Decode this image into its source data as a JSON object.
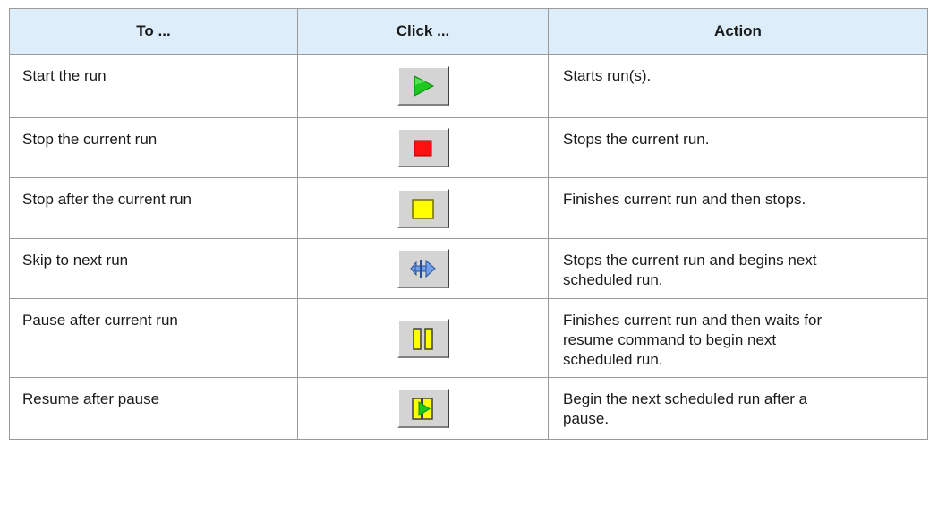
{
  "headers": {
    "to": "To ...",
    "click": "Click ...",
    "action": "Action"
  },
  "rows": [
    {
      "to": "Start the run",
      "icon": "start-run-icon",
      "action_lines": [
        "Starts run(s)."
      ]
    },
    {
      "to": "Stop the current run",
      "icon": "stop-run-icon",
      "action_lines": [
        "Stops the current run."
      ]
    },
    {
      "to": "Stop after the current run",
      "icon": "stop-after-run-icon",
      "action_lines": [
        "Finishes current run and then stops."
      ]
    },
    {
      "to": "Skip to next run",
      "icon": "skip-next-run-icon",
      "action_lines": [
        "Stops the current run and begins next",
        "scheduled run."
      ]
    },
    {
      "to": "Pause after current run",
      "icon": "pause-after-run-icon",
      "action_lines": [
        "Finishes current run and then waits for",
        "resume command to begin next",
        "scheduled run."
      ]
    },
    {
      "to": "Resume after pause",
      "icon": "resume-after-pause-icon",
      "action_lines": [
        "Begin the next scheduled run after a",
        "pause."
      ]
    }
  ],
  "colors": {
    "header_bg": "#ddeefa",
    "play_green": "#1ec81e",
    "stop_red": "#ff1010",
    "stop_after_yellow": "#ffff00",
    "skip_blue": "#6f9fe8"
  }
}
